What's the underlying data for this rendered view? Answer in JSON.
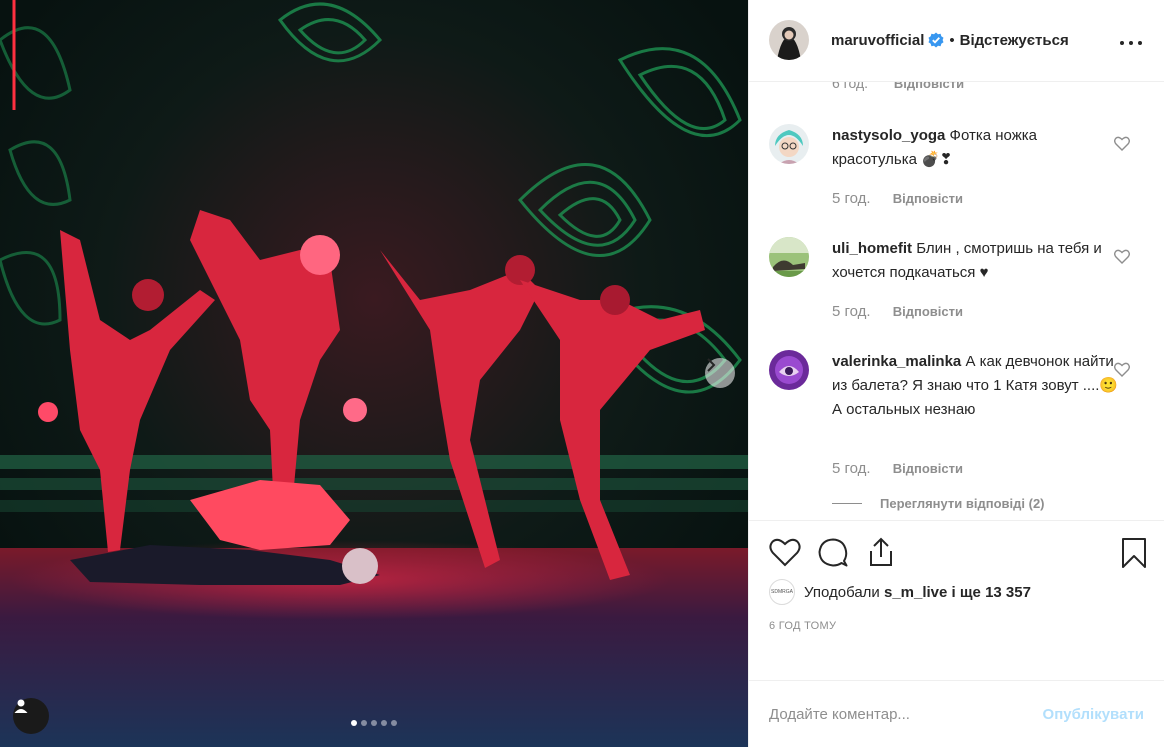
{
  "post": {
    "username": "maruvofficial",
    "follow_status": "Відстежується",
    "separator": "•",
    "icons": {
      "verified": "verified-badge-icon",
      "more": "more-options-icon",
      "next": "chevron-right-icon",
      "tag": "user-tag-icon"
    },
    "carousel": {
      "count": 5,
      "active_index": 0
    }
  },
  "comments": {
    "cut_top": {
      "time": "6 год.",
      "reply": "Відповісти"
    },
    "items": [
      {
        "user": "nastysolo_yoga",
        "text": "Фотка ножка красотулька 💣❣",
        "time": "5 год.",
        "reply": "Відповісти"
      },
      {
        "user": "uli_homefit",
        "text": "Блин , смотришь на тебя и хочется подкачаться ♥",
        "time": "5 год.",
        "reply": "Відповісти"
      },
      {
        "user": "valerinka_malinka",
        "text": "А как девчонок найти из балета? Я знаю что 1 Катя зовут ....🙂 А остальных незнаю",
        "time": "5 год.",
        "reply": "Відповісти"
      }
    ],
    "view_replies": "Переглянути відповіді (2)"
  },
  "actions": {
    "icons": [
      "heart-icon",
      "comment-icon",
      "share-icon",
      "bookmark-icon"
    ],
    "likes_prefix": "Уподобали",
    "likes_user": "s_m_live",
    "likes_middle": "і ще",
    "likes_count": "13 357",
    "mini_avatar_text": "SDMRGA",
    "timestamp": "6 ГОД ТОМУ"
  },
  "add_comment": {
    "placeholder": "Додайте коментар...",
    "publish": "Опублікувати"
  },
  "colors": {
    "text": "#262626",
    "secondary": "#8e8e8e",
    "publish_disabled": "#b2dffc",
    "verified": "#3897f0",
    "heart_red": "#c0192e"
  }
}
